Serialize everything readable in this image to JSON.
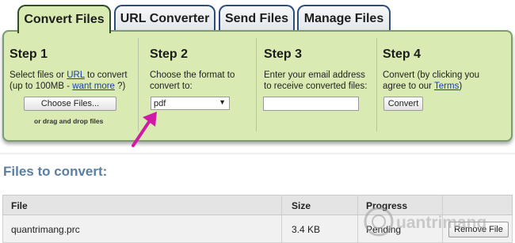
{
  "tabs": [
    {
      "label": "Convert Files",
      "active": true
    },
    {
      "label": "URL Converter",
      "active": false
    },
    {
      "label": "Send Files",
      "active": false
    },
    {
      "label": "Manage Files",
      "active": false
    }
  ],
  "steps": {
    "step1": {
      "title": "Step 1",
      "desc_before_link": "Select files or ",
      "link1": "URL",
      "desc_after_link": " to convert",
      "desc_line2_before": "(up to 100MB - ",
      "link2": "want more",
      "desc_line2_after": " ?)",
      "button": "Choose Files...",
      "drag_text": "or drag and drop files"
    },
    "step2": {
      "title": "Step 2",
      "desc": "Choose the format to convert to:",
      "format_value": "pdf"
    },
    "step3": {
      "title": "Step 3",
      "desc": "Enter your email address to receive converted files:",
      "email_value": ""
    },
    "step4": {
      "title": "Step 4",
      "desc_line1": "Convert (by clicking you",
      "desc_line2_before": "agree to our ",
      "terms_link": "Terms",
      "desc_line2_after": ")",
      "button": "Convert"
    }
  },
  "files_section": {
    "title": "Files to convert:",
    "columns": [
      "File",
      "Size",
      "Progress"
    ],
    "rows": [
      {
        "file": "quantrimang.prc",
        "size": "3.4 KB",
        "progress": "Pending",
        "action": "Remove File"
      }
    ]
  },
  "watermark": "uantrimang",
  "colors": {
    "panel": "#d9ebb2",
    "arrow": "#d11aa6",
    "section_title": "#5b7ea3",
    "link": "#1a3fa8"
  }
}
